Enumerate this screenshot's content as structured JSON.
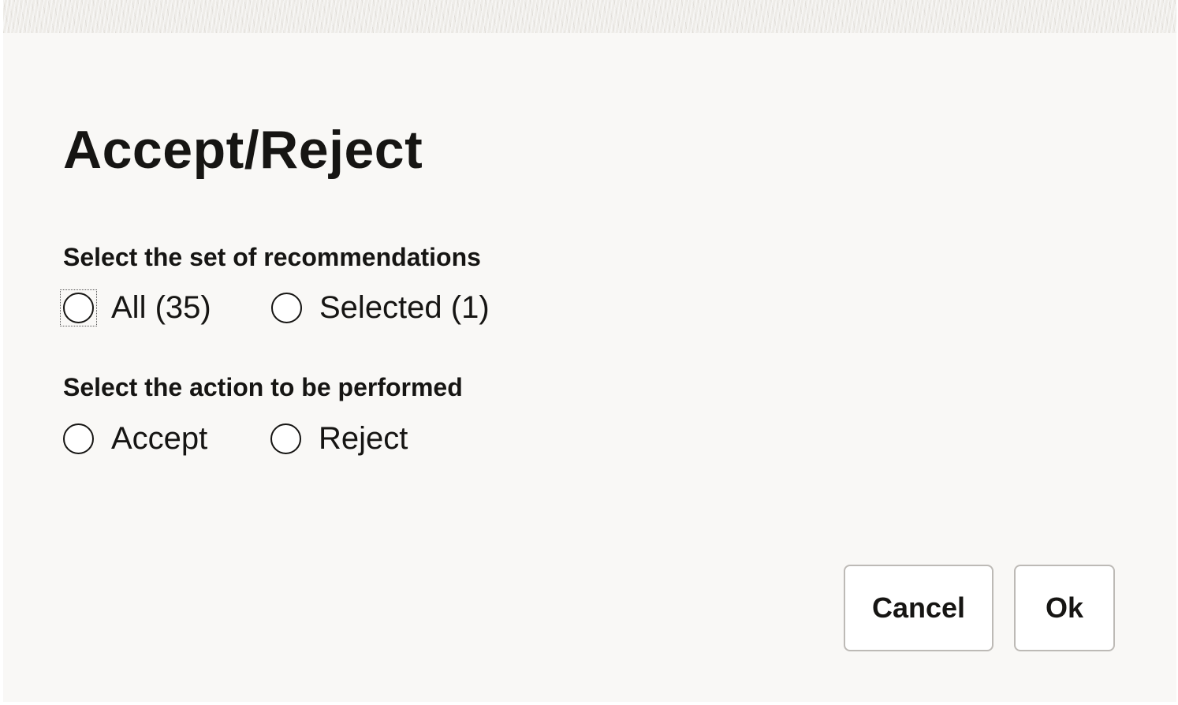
{
  "dialog": {
    "title": "Accept/Reject"
  },
  "recommendation_set": {
    "label": "Select the set of recommendations",
    "options": [
      {
        "label": "All (35)",
        "checked": false,
        "focused": true
      },
      {
        "label": "Selected (1)",
        "checked": false,
        "focused": false
      }
    ]
  },
  "action": {
    "label": "Select the action to be performed",
    "options": [
      {
        "label": "Accept",
        "checked": false
      },
      {
        "label": "Reject",
        "checked": false
      }
    ]
  },
  "buttons": {
    "cancel_label": "Cancel",
    "ok_label": "Ok"
  }
}
